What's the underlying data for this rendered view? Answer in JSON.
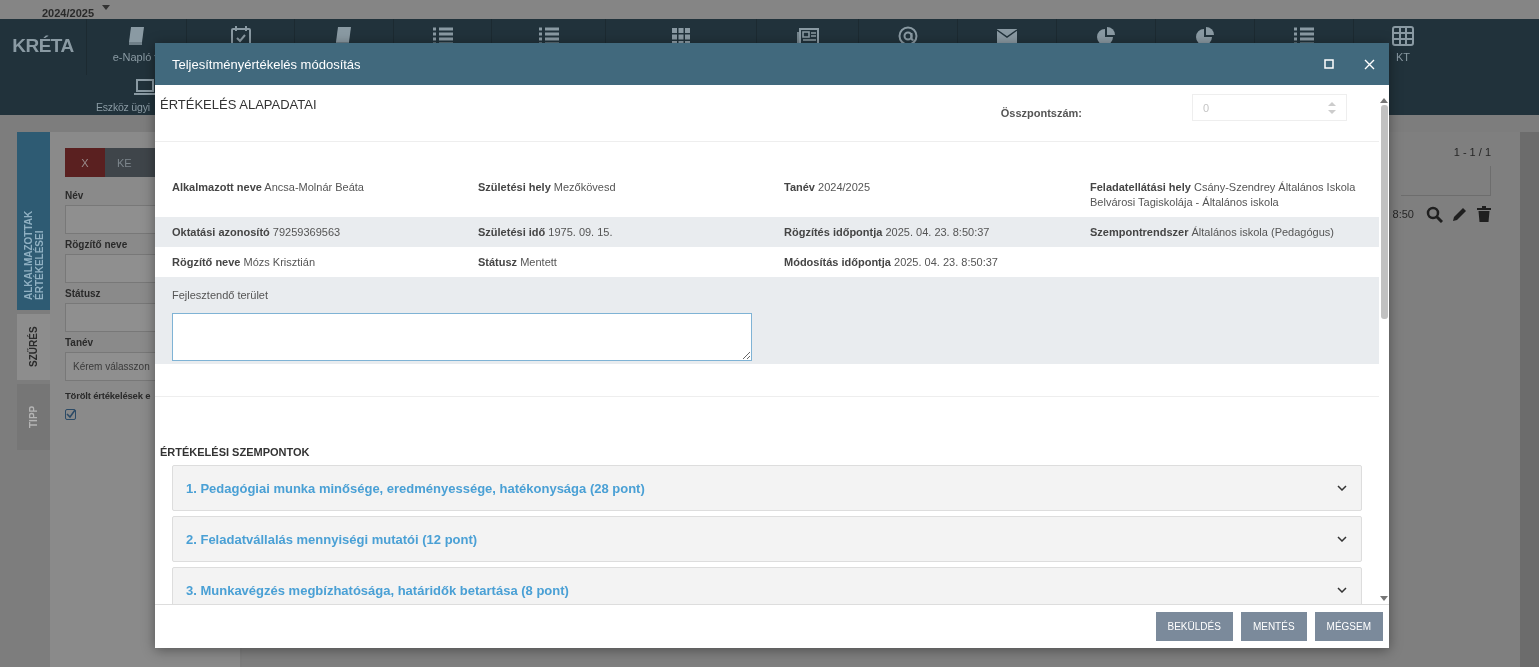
{
  "top_bar": {
    "school_year": "2024/2025"
  },
  "nav": {
    "logo": "KRÉTA",
    "items": [
      {
        "kind": "book",
        "label": "e-Napló",
        "dropdown": true
      },
      {
        "kind": "calendar"
      },
      {
        "kind": "book"
      },
      {
        "kind": "list"
      },
      {
        "kind": "list"
      },
      {
        "kind": "grid"
      },
      {
        "kind": "newspaper"
      },
      {
        "kind": "at"
      },
      {
        "kind": "envelope"
      },
      {
        "kind": "pie"
      },
      {
        "kind": "pie"
      },
      {
        "kind": "list"
      },
      {
        "kind": "table",
        "label": "KT"
      }
    ],
    "second_row": [
      {
        "kind": "laptop",
        "label": "Eszköz ügyi"
      }
    ]
  },
  "sidebar_tabs": [
    {
      "label": "ALKALMAZOTTAK ÉRTÉKELÉSEI",
      "selected": true,
      "disabled": false
    },
    {
      "label": "SZŰRÉS",
      "selected": false,
      "disabled": false
    },
    {
      "label": "TIPP",
      "selected": false,
      "disabled": true
    }
  ],
  "filter": {
    "buttons": [
      {
        "label": "X",
        "kind": "clear"
      },
      {
        "label": "KE",
        "kind": "search"
      }
    ],
    "fields": [
      {
        "label": "Név"
      },
      {
        "label": "Rögzítő neve"
      },
      {
        "label": "Státusz"
      },
      {
        "label": "Tanév",
        "placeholder": "Kérem válasszon"
      }
    ],
    "checkbox": {
      "label": "Törölt értékelések e",
      "checked": true
    }
  },
  "results": {
    "pager": "1 - 1 / 1",
    "row": {
      "time": "8:50"
    }
  },
  "modal": {
    "title": "Teljesítményértékelés módosítás",
    "section_title": "ÉRTÉKELÉS ALAPADATAI",
    "total": {
      "label": "Összpontszám:",
      "value": "0",
      "disabled": true
    },
    "rows": [
      [
        {
          "label": "Alkalmazott neve",
          "value": "Ancsa-Molnár Beáta"
        },
        {
          "label": "Születési hely",
          "value": "Mezőkövesd"
        },
        {
          "label": "Tanév",
          "value": "2024/2025"
        },
        {
          "label": "Feladatellátási hely",
          "value": "Csány-Szendrey Általános Iskola Belvárosi Tagiskolája - Általános iskola"
        }
      ],
      [
        {
          "label": "Oktatási azonosító",
          "value": "79259369563"
        },
        {
          "label": "Születési idő",
          "value": "1975. 09. 15."
        },
        {
          "label": "Rögzítés időpontja",
          "value": "2025. 04. 23. 8:50:37"
        },
        {
          "label": "Szempontrendszer",
          "value": "Általános iskola (Pedagógus)"
        }
      ],
      [
        {
          "label": "Rögzítő neve",
          "value": "Mózs Krisztián"
        },
        {
          "label": "Státusz",
          "value": "Mentett"
        },
        {
          "label": "Módosítás időpontja",
          "value": "2025. 04. 23. 8:50:37"
        }
      ]
    ],
    "development_area": {
      "label": "Fejlesztendő terület"
    },
    "criteria": {
      "title": "ÉRTÉKELÉSI SZEMPONTOK",
      "items": [
        {
          "label": "1. Pedagógiai munka minősége, eredményessége, hatékonysága (28 pont)",
          "expanded": false
        },
        {
          "label": "2. Feladatvállalás mennyiségi mutatói (12 pont)",
          "expanded": false
        },
        {
          "label": "3. Munkavégzés megbízhatósága, határidők betartása (8 pont)",
          "expanded": false
        }
      ]
    },
    "buttons": [
      "BEKÜLDÉS",
      "MENTÉS",
      "MÉGSEM"
    ]
  }
}
